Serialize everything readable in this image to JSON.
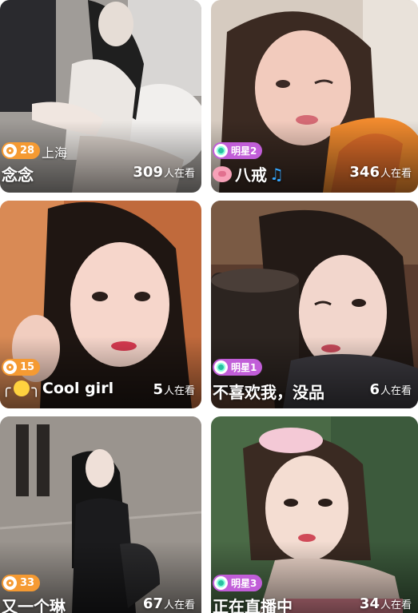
{
  "cards": [
    {
      "badge": {
        "type": "level",
        "text": "28"
      },
      "city": "上海",
      "name": "念念",
      "viewers": {
        "count": "309",
        "label": "人在看"
      },
      "palette": {
        "bg": "#9c9c9c",
        "hair": "#242424",
        "skin": "#e8dfd8"
      }
    },
    {
      "badge": {
        "type": "star",
        "text": "明星2"
      },
      "name": "八戒",
      "viewers": {
        "count": "346",
        "label": "人在看"
      },
      "palette": {
        "bg": "#c9b9a8",
        "hair": "#3a2820",
        "skin": "#f3c9ba"
      }
    },
    {
      "badge": {
        "type": "level",
        "text": "15"
      },
      "name": "Cool girl",
      "viewers": {
        "count": "5",
        "label": "人在看"
      },
      "palette": {
        "bg": "#b8643a",
        "hair": "#1c1410",
        "skin": "#f5d0c4"
      }
    },
    {
      "badge": {
        "type": "star",
        "text": "明星1"
      },
      "name": "不喜欢我，没品",
      "viewers": {
        "count": "6",
        "label": "人在看"
      },
      "palette": {
        "bg": "#6b4a3a",
        "hair": "#241a16",
        "skin": "#f1d3c9"
      }
    },
    {
      "badge": {
        "type": "level",
        "text": "33"
      },
      "name": "又一个琳",
      "viewers": {
        "count": "67",
        "label": "人在看"
      },
      "palette": {
        "bg": "#8d8a86",
        "hair": "#141414",
        "skin": "#efe2da"
      }
    },
    {
      "badge": {
        "type": "star",
        "text": "明星3"
      },
      "name": "正在直播中",
      "viewers": {
        "count": "34",
        "label": "人在看"
      },
      "palette": {
        "bg": "#4f6b48",
        "hair": "#3a2a22",
        "skin": "#f4ddd2"
      }
    }
  ]
}
